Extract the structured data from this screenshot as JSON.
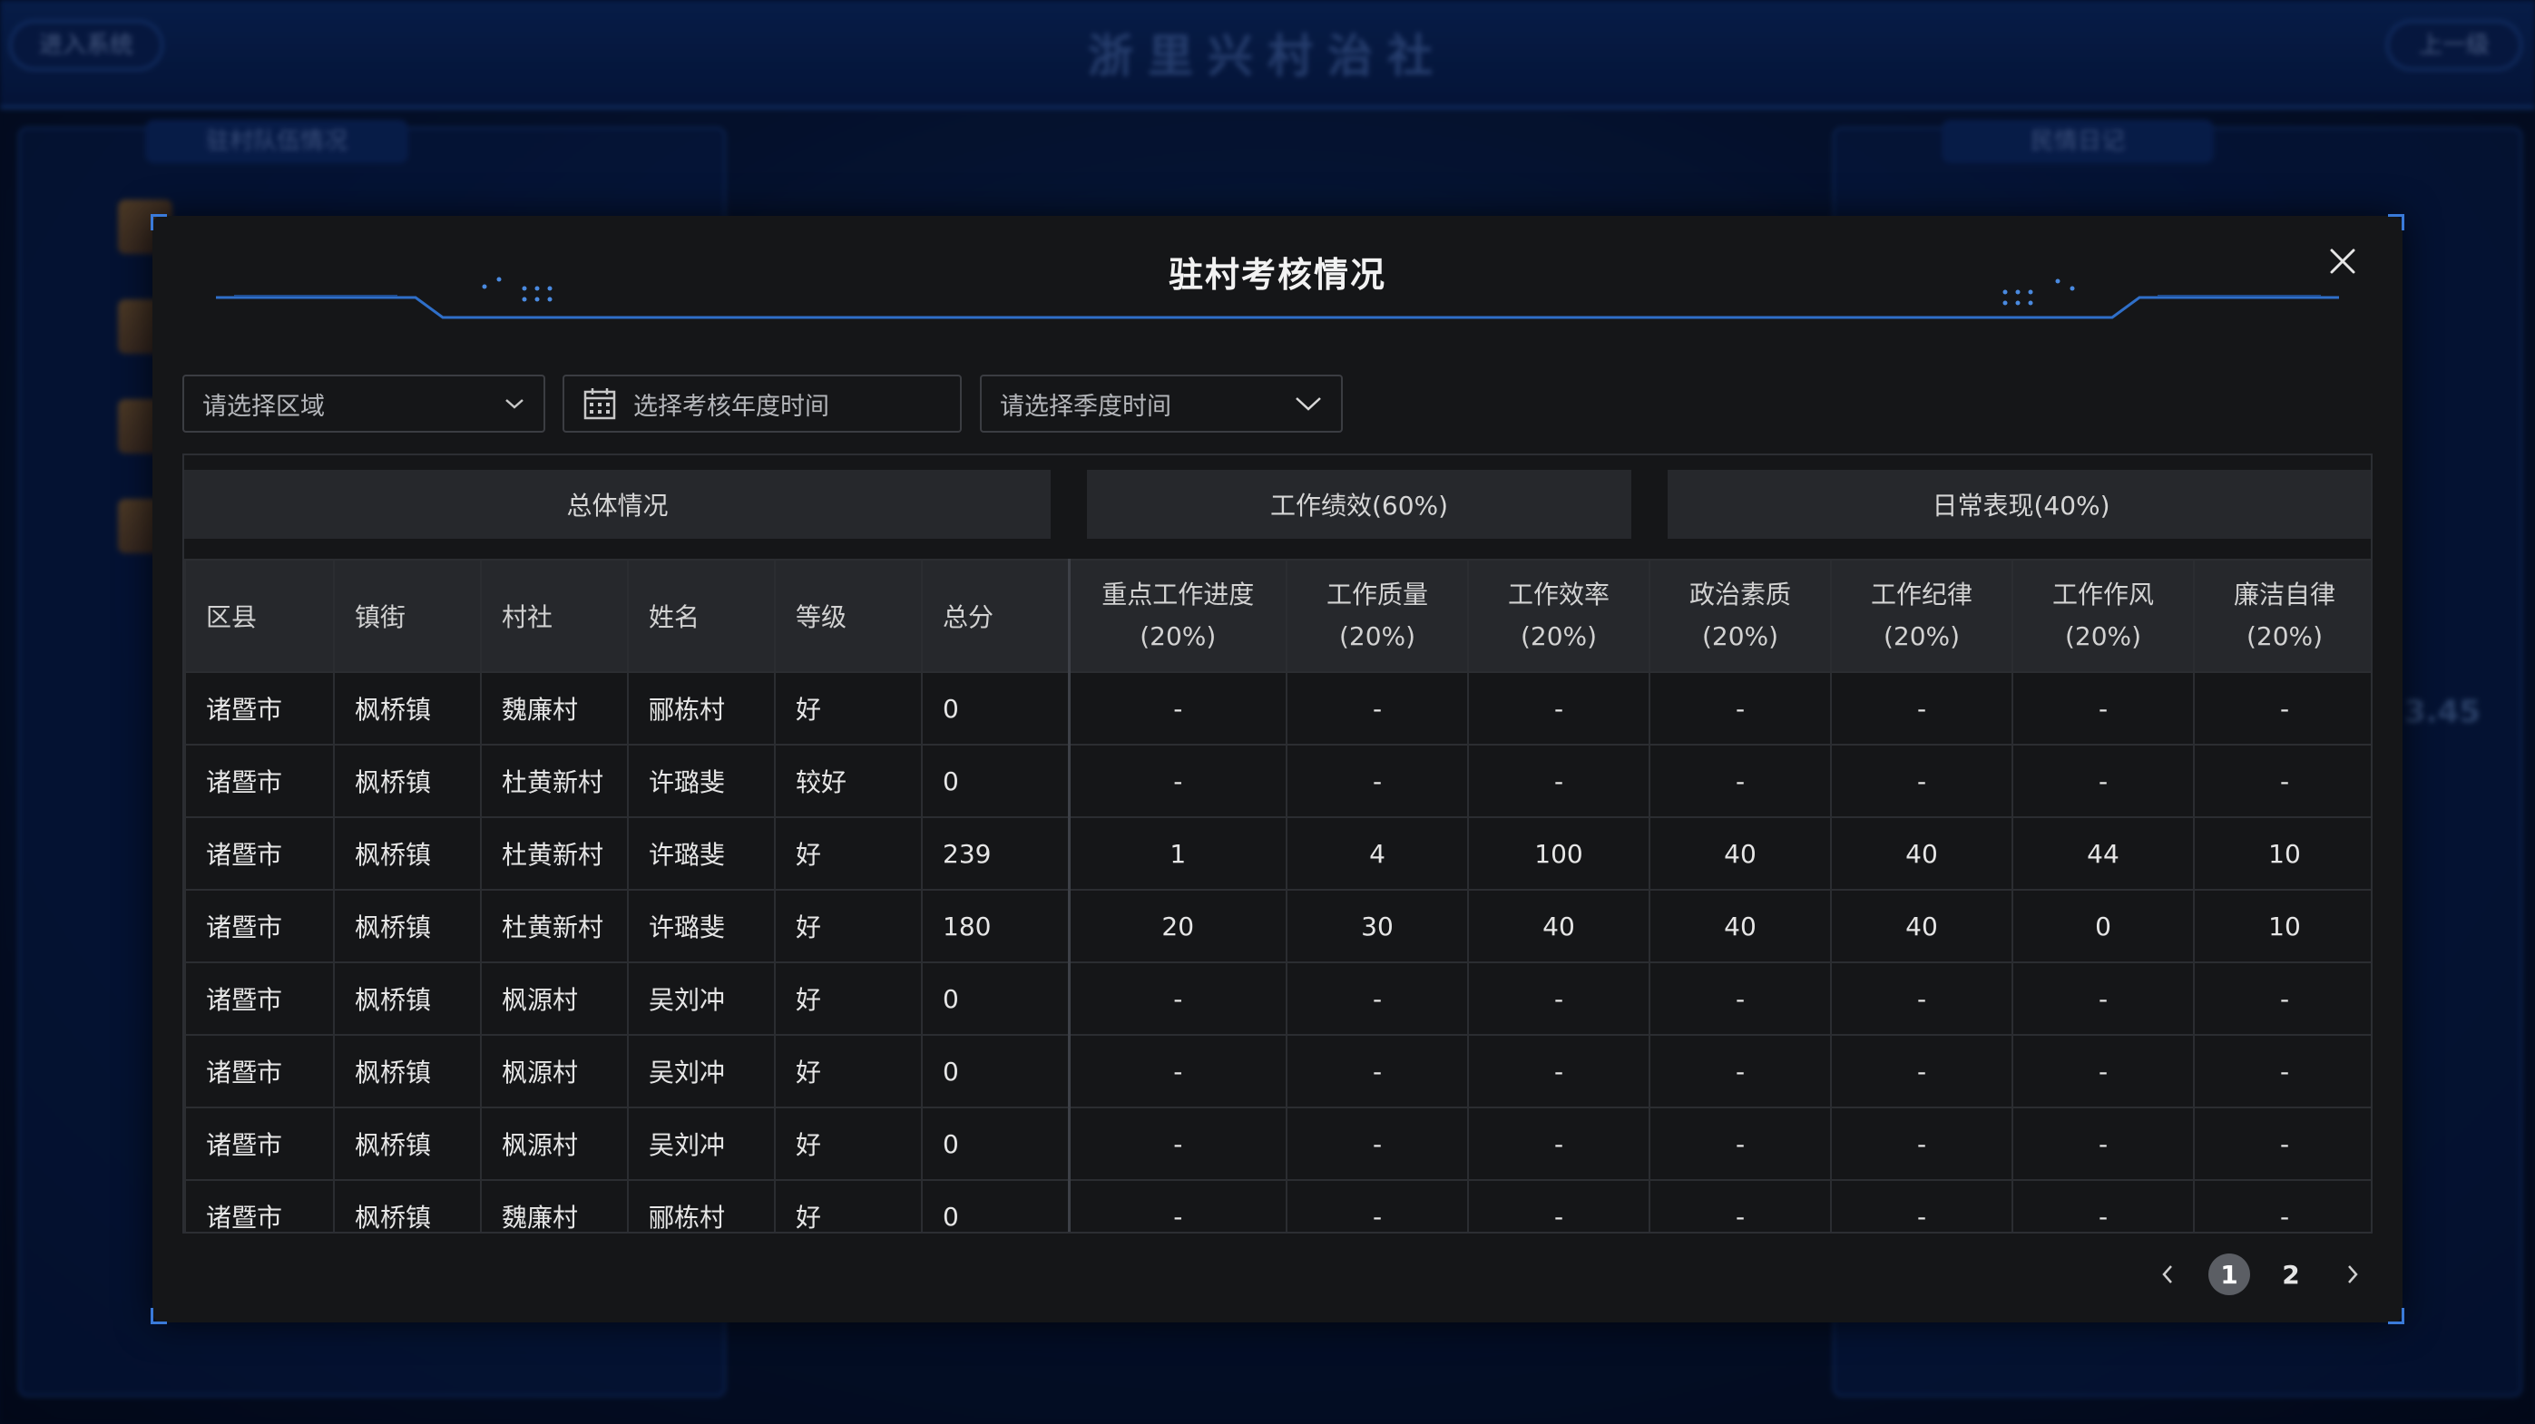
{
  "background": {
    "title": "浙里兴村治社",
    "left_pill": "进入系统",
    "right_pill": "上一级",
    "left_panel_title": "驻村队伍情况",
    "right_panel_title": "民情日记",
    "side_number": "3.45"
  },
  "modal": {
    "title": "驻村考核情况",
    "filters": {
      "region_placeholder": "请选择区域",
      "year_placeholder": "选择考核年度时间",
      "quarter_placeholder": "请选择季度时间"
    },
    "groups": {
      "overall": "总体情况",
      "performance": "工作绩效(60%)",
      "daily": "日常表现(40%)"
    },
    "columns": [
      {
        "l1": "区县",
        "l2": ""
      },
      {
        "l1": "镇街",
        "l2": ""
      },
      {
        "l1": "村社",
        "l2": ""
      },
      {
        "l1": "姓名",
        "l2": ""
      },
      {
        "l1": "等级",
        "l2": ""
      },
      {
        "l1": "总分",
        "l2": ""
      },
      {
        "l1": "重点工作进度",
        "l2": "(20%)"
      },
      {
        "l1": "工作质量",
        "l2": "(20%)"
      },
      {
        "l1": "工作效率",
        "l2": "(20%)"
      },
      {
        "l1": "政治素质",
        "l2": "(20%)"
      },
      {
        "l1": "工作纪律",
        "l2": "(20%)"
      },
      {
        "l1": "工作作风",
        "l2": "(20%)"
      },
      {
        "l1": "廉洁自律",
        "l2": "(20%)"
      }
    ],
    "rows": [
      [
        "诸暨市",
        "枫桥镇",
        "魏廉村",
        "郦栋村",
        "好",
        "0",
        "-",
        "-",
        "-",
        "-",
        "-",
        "-",
        "-"
      ],
      [
        "诸暨市",
        "枫桥镇",
        "杜黄新村",
        "许璐斐",
        "较好",
        "0",
        "-",
        "-",
        "-",
        "-",
        "-",
        "-",
        "-"
      ],
      [
        "诸暨市",
        "枫桥镇",
        "杜黄新村",
        "许璐斐",
        "好",
        "239",
        "1",
        "4",
        "100",
        "40",
        "40",
        "44",
        "10"
      ],
      [
        "诸暨市",
        "枫桥镇",
        "杜黄新村",
        "许璐斐",
        "好",
        "180",
        "20",
        "30",
        "40",
        "40",
        "40",
        "0",
        "10"
      ],
      [
        "诸暨市",
        "枫桥镇",
        "枫源村",
        "吴刘冲",
        "好",
        "0",
        "-",
        "-",
        "-",
        "-",
        "-",
        "-",
        "-"
      ],
      [
        "诸暨市",
        "枫桥镇",
        "枫源村",
        "吴刘冲",
        "好",
        "0",
        "-",
        "-",
        "-",
        "-",
        "-",
        "-",
        "-"
      ],
      [
        "诸暨市",
        "枫桥镇",
        "枫源村",
        "吴刘冲",
        "好",
        "0",
        "-",
        "-",
        "-",
        "-",
        "-",
        "-",
        "-"
      ],
      [
        "诸暨市",
        "枫桥镇",
        "魏廉村",
        "郦栋村",
        "好",
        "0",
        "-",
        "-",
        "-",
        "-",
        "-",
        "-",
        "-"
      ]
    ],
    "pagination": {
      "pages": [
        "1",
        "2"
      ],
      "current": "1"
    }
  }
}
